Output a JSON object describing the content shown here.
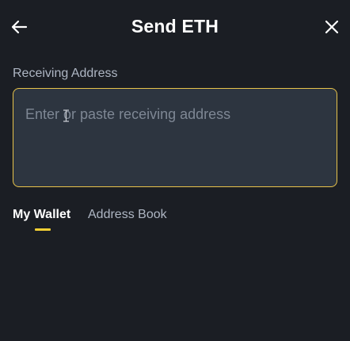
{
  "header": {
    "title": "Send ETH",
    "back_icon": "arrow-left-icon",
    "close_icon": "close-icon"
  },
  "receiving": {
    "label": "Receiving Address",
    "placeholder": "Enter or paste receiving address",
    "value": ""
  },
  "tabs": [
    {
      "label": "My Wallet",
      "active": true
    },
    {
      "label": "Address Book",
      "active": false
    }
  ],
  "colors": {
    "background": "#1b1e24",
    "input_background": "#2d3540",
    "accent": "#f3cf34",
    "input_border": "#e8c34a",
    "muted_text": "#aeb6c3"
  }
}
